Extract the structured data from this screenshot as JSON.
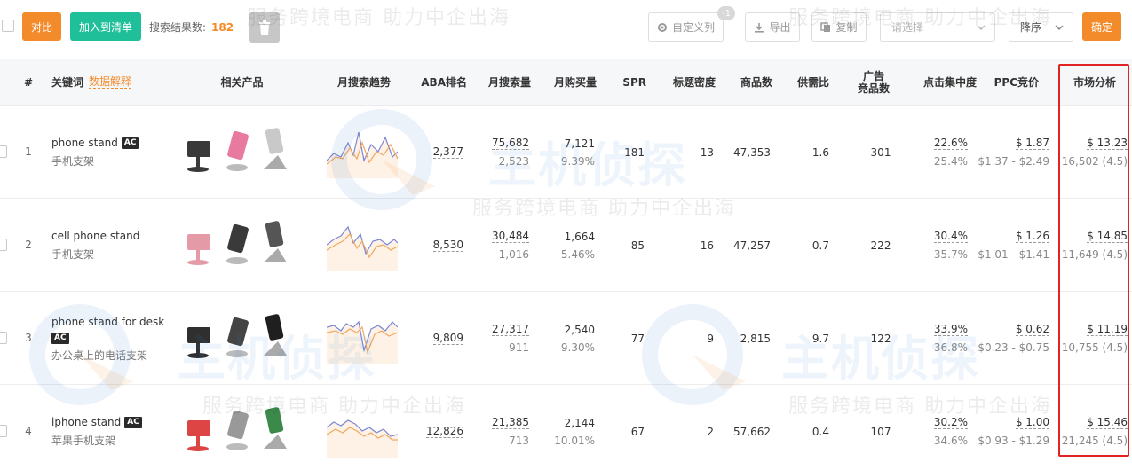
{
  "toolbar": {
    "compare_label": "对比",
    "add_list_label": "加入到清单",
    "result_label": "搜索结果数:",
    "result_count": "182",
    "custom_columns_label": "自定义列",
    "custom_columns_badge": "-1",
    "export_label": "导出",
    "copy_label": "复制",
    "select_placeholder": "请选择",
    "sort_label": "降序",
    "confirm_label": "确定"
  },
  "columns": {
    "index": "#",
    "keyword": "关键词",
    "keyword_link": "数据解释",
    "products": "相关产品",
    "trend": "月搜索趋势",
    "aba_rank": "ABA排名",
    "monthly_search": "月搜索量",
    "monthly_purchase": "月购买量",
    "spr": "SPR",
    "title_density": "标题密度",
    "product_count": "商品数",
    "supply_demand": "供需比",
    "ad_products_line1": "广告",
    "ad_products_line2": "竞品数",
    "click_concentration": "点击集中度",
    "ppc_bid": "PPC竞价",
    "market_analysis": "市场分析"
  },
  "rows": [
    {
      "index": "1",
      "keyword": "phone stand",
      "ac": "AC",
      "keyword_cn": "手机支架",
      "aba_rank": "2,377",
      "search_main": "75,682",
      "search_sub": "2,523",
      "purchase_main": "7,121",
      "purchase_sub": "9.39%",
      "spr": "181",
      "title_density": "13",
      "product_count": "47,353",
      "supply_demand": "1.6",
      "ad_products": "301",
      "click_main": "22.6%",
      "click_sub": "25.4%",
      "ppc_main": "$ 1.87",
      "ppc_sub": "$1.37 - $2.49",
      "market_main": "$ 13.23",
      "market_sub": "16,502 (4.5)"
    },
    {
      "index": "2",
      "keyword": "cell phone stand",
      "ac": "",
      "keyword_cn": "手机支架",
      "aba_rank": "8,530",
      "search_main": "30,484",
      "search_sub": "1,016",
      "purchase_main": "1,664",
      "purchase_sub": "5.46%",
      "spr": "85",
      "title_density": "16",
      "product_count": "47,257",
      "supply_demand": "0.7",
      "ad_products": "222",
      "click_main": "30.4%",
      "click_sub": "35.7%",
      "ppc_main": "$ 1.26",
      "ppc_sub": "$1.01 - $1.41",
      "market_main": "$ 14.85",
      "market_sub": "11,649 (4.5)"
    },
    {
      "index": "3",
      "keyword": "phone stand for desk",
      "ac": "AC",
      "keyword_cn": "办公桌上的电话支架",
      "aba_rank": "9,809",
      "search_main": "27,317",
      "search_sub": "911",
      "purchase_main": "2,540",
      "purchase_sub": "9.30%",
      "spr": "77",
      "title_density": "9",
      "product_count": "2,815",
      "supply_demand": "9.7",
      "ad_products": "122",
      "click_main": "33.9%",
      "click_sub": "36.8%",
      "ppc_main": "$ 0.62",
      "ppc_sub": "$0.23 - $0.75",
      "market_main": "$ 11.19",
      "market_sub": "10,755 (4.5)"
    },
    {
      "index": "4",
      "keyword": "iphone stand",
      "ac": "AC",
      "keyword_cn": "苹果手机支架",
      "aba_rank": "12,826",
      "search_main": "21,385",
      "search_sub": "713",
      "purchase_main": "2,144",
      "purchase_sub": "10.01%",
      "spr": "67",
      "title_density": "2",
      "product_count": "57,662",
      "supply_demand": "0.4",
      "ad_products": "107",
      "click_main": "30.2%",
      "click_sub": "34.6%",
      "ppc_main": "$ 1.00",
      "ppc_sub": "$0.93 - $1.29",
      "market_main": "$ 15.46",
      "market_sub": "21,245 (4.5)"
    }
  ],
  "watermark": {
    "slogan": "服务跨境电商 助力中企出海",
    "brand": "主机侦探"
  },
  "colors": {
    "accent_orange": "#f48b2b",
    "accent_teal": "#1fbf9a",
    "highlight_red": "#e02424"
  },
  "icons": {
    "trash": "trash-icon",
    "settings": "gear-icon",
    "export": "download-icon",
    "copy": "copy-icon",
    "chevron": "chevron-down-icon"
  }
}
